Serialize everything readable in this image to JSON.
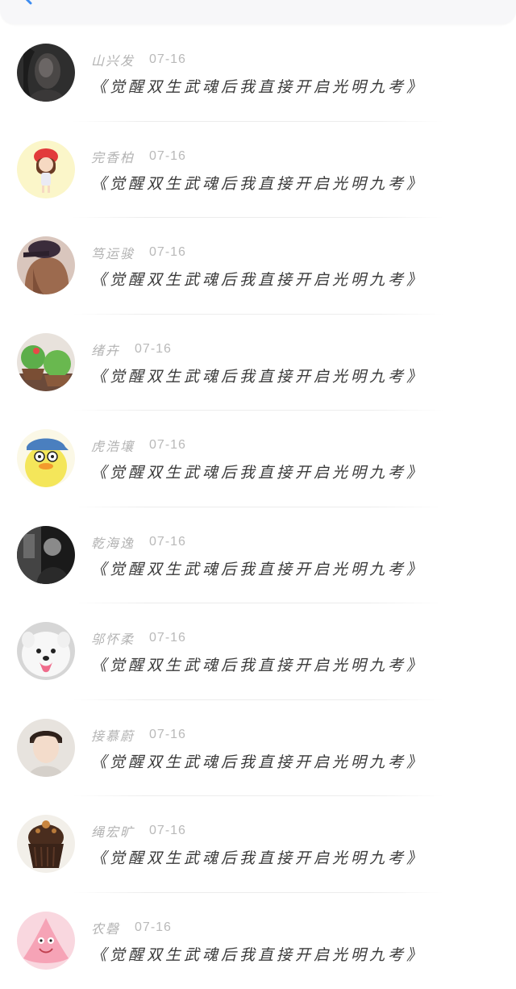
{
  "header": {
    "back_icon": "chevron-left-icon",
    "accent_color": "#3d8cf0"
  },
  "comments": [
    {
      "user": "山兴发",
      "date": "07-16",
      "title": "《觉醒双生武魂后我直接开启光明九考》",
      "avatar": "dark-portrait"
    },
    {
      "user": "完香柏",
      "date": "07-16",
      "title": "《觉醒双生武魂后我直接开启光明九考》",
      "avatar": "cartoon-girl-red-hat"
    },
    {
      "user": "笃运骏",
      "date": "07-16",
      "title": "《觉醒双生武魂后我直接开启光明九考》",
      "avatar": "girl-with-cap"
    },
    {
      "user": "绪卉",
      "date": "07-16",
      "title": "《觉醒双生武魂后我直接开启光明九考》",
      "avatar": "green-cupcakes"
    },
    {
      "user": "虎浩壤",
      "date": "07-16",
      "title": "《觉醒双生武魂后我直接开启光明九考》",
      "avatar": "cartoon-duck"
    },
    {
      "user": "乾海逸",
      "date": "07-16",
      "title": "《觉醒双生武魂后我直接开启光明九考》",
      "avatar": "black-white-portrait"
    },
    {
      "user": "邬怀柔",
      "date": "07-16",
      "title": "《觉醒双生武魂后我直接开启光明九考》",
      "avatar": "white-dog"
    },
    {
      "user": "接慕蔚",
      "date": "07-16",
      "title": "《觉醒双生武魂后我直接开启光明九考》",
      "avatar": "boy-portrait"
    },
    {
      "user": "绳宏旷",
      "date": "07-16",
      "title": "《觉醒双生武魂后我直接开启光明九考》",
      "avatar": "chocolate-cupcake"
    },
    {
      "user": "农磬",
      "date": "07-16",
      "title": "《觉醒双生武魂后我直接开启光明九考》",
      "avatar": "pink-starfish"
    }
  ]
}
